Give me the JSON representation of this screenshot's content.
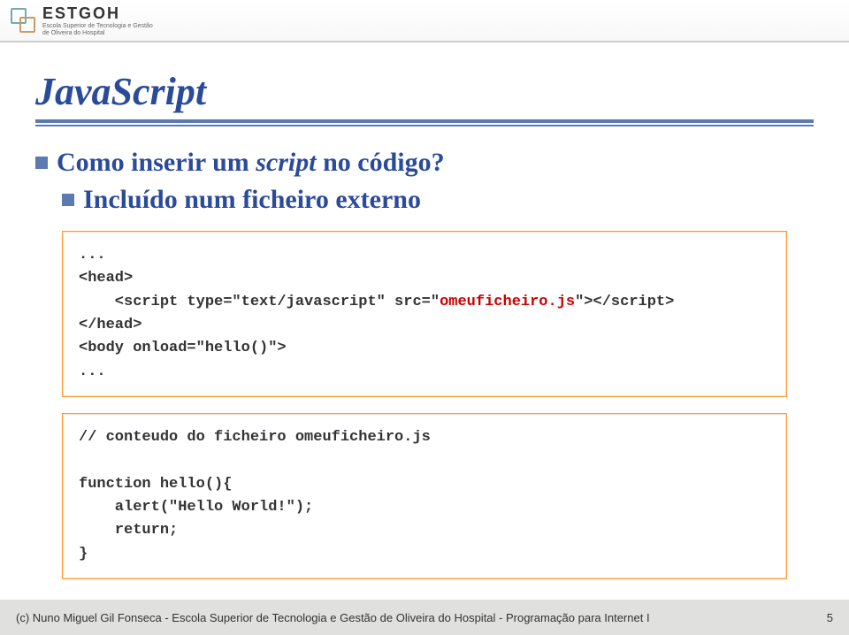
{
  "header": {
    "logo_text": "ESTGOH",
    "logo_sub1": "Escola Superior de Tecnologia e Gestão",
    "logo_sub2": "de Oliveira do Hospital"
  },
  "slide": {
    "title": "JavaScript",
    "bullet1_prefix": "Como inserir um ",
    "bullet1_italic": "script",
    "bullet1_suffix": " no código?",
    "bullet2": "Incluído num ficheiro externo",
    "code1_line1": "...",
    "code1_line2": "<head>",
    "code1_line3_a": "    <script type=\"text/javascript\" src=\"",
    "code1_line3_b": "omeuficheiro.js",
    "code1_line3_c": "\"></script>",
    "code1_line4": "</head>",
    "code1_line5": "<body onload=\"hello()\">",
    "code1_line6": "...",
    "code2_line1": "// conteudo do ficheiro omeuficheiro.js",
    "code2_line2": "",
    "code2_line3": "function hello(){",
    "code2_line4": "    alert(\"Hello World!\");",
    "code2_line5": "    return;",
    "code2_line6": "}"
  },
  "footer": {
    "left": "(c) Nuno Miguel Gil Fonseca  -  Escola Superior de Tecnologia e Gestão de Oliveira do Hospital  -  Programação para Internet I",
    "page": "5"
  }
}
